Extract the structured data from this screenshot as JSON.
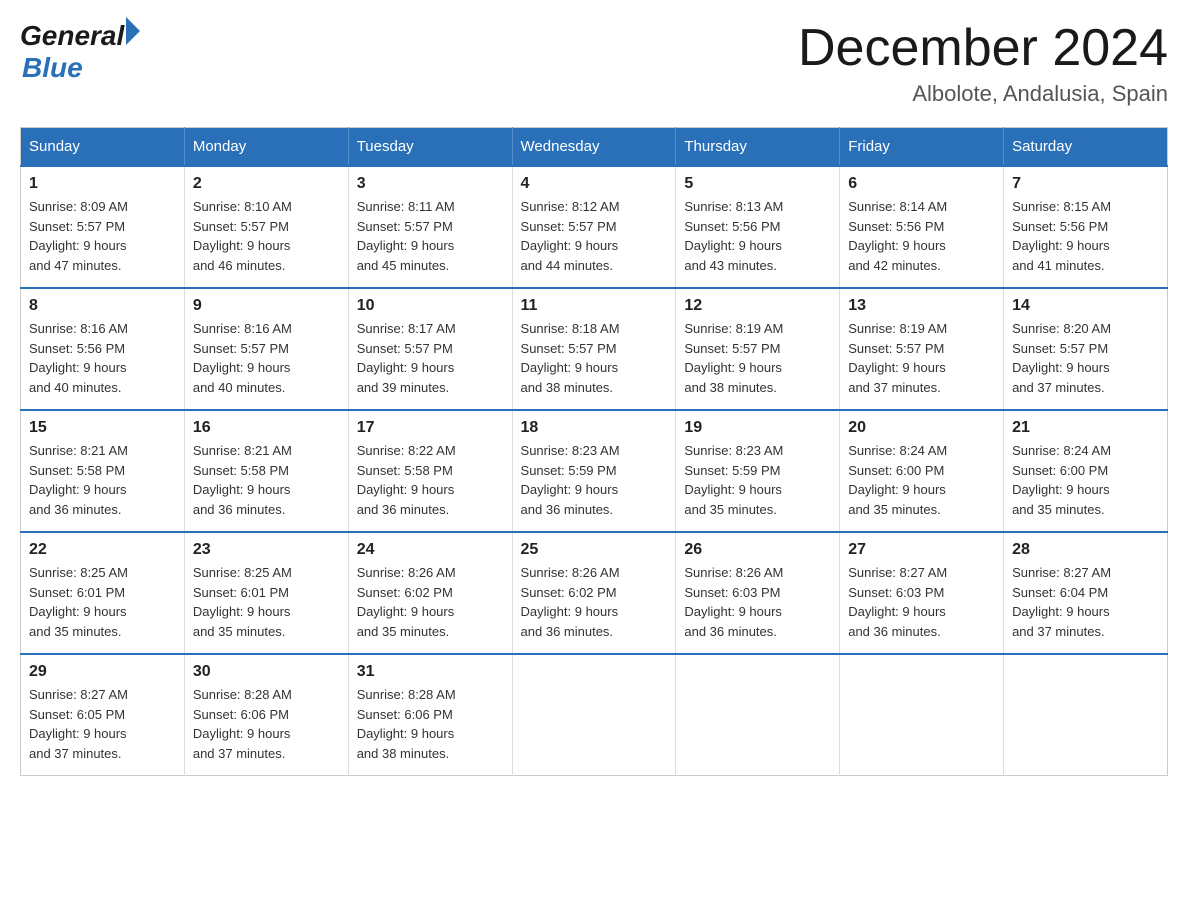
{
  "logo": {
    "general": "General",
    "arrow": "▶",
    "blue": "Blue"
  },
  "header": {
    "month_year": "December 2024",
    "location": "Albolote, Andalusia, Spain"
  },
  "days_of_week": [
    "Sunday",
    "Monday",
    "Tuesday",
    "Wednesday",
    "Thursday",
    "Friday",
    "Saturday"
  ],
  "weeks": [
    [
      {
        "day": "1",
        "sunrise": "8:09 AM",
        "sunset": "5:57 PM",
        "daylight": "9 hours and 47 minutes."
      },
      {
        "day": "2",
        "sunrise": "8:10 AM",
        "sunset": "5:57 PM",
        "daylight": "9 hours and 46 minutes."
      },
      {
        "day": "3",
        "sunrise": "8:11 AM",
        "sunset": "5:57 PM",
        "daylight": "9 hours and 45 minutes."
      },
      {
        "day": "4",
        "sunrise": "8:12 AM",
        "sunset": "5:57 PM",
        "daylight": "9 hours and 44 minutes."
      },
      {
        "day": "5",
        "sunrise": "8:13 AM",
        "sunset": "5:56 PM",
        "daylight": "9 hours and 43 minutes."
      },
      {
        "day": "6",
        "sunrise": "8:14 AM",
        "sunset": "5:56 PM",
        "daylight": "9 hours and 42 minutes."
      },
      {
        "day": "7",
        "sunrise": "8:15 AM",
        "sunset": "5:56 PM",
        "daylight": "9 hours and 41 minutes."
      }
    ],
    [
      {
        "day": "8",
        "sunrise": "8:16 AM",
        "sunset": "5:56 PM",
        "daylight": "9 hours and 40 minutes."
      },
      {
        "day": "9",
        "sunrise": "8:16 AM",
        "sunset": "5:57 PM",
        "daylight": "9 hours and 40 minutes."
      },
      {
        "day": "10",
        "sunrise": "8:17 AM",
        "sunset": "5:57 PM",
        "daylight": "9 hours and 39 minutes."
      },
      {
        "day": "11",
        "sunrise": "8:18 AM",
        "sunset": "5:57 PM",
        "daylight": "9 hours and 38 minutes."
      },
      {
        "day": "12",
        "sunrise": "8:19 AM",
        "sunset": "5:57 PM",
        "daylight": "9 hours and 38 minutes."
      },
      {
        "day": "13",
        "sunrise": "8:19 AM",
        "sunset": "5:57 PM",
        "daylight": "9 hours and 37 minutes."
      },
      {
        "day": "14",
        "sunrise": "8:20 AM",
        "sunset": "5:57 PM",
        "daylight": "9 hours and 37 minutes."
      }
    ],
    [
      {
        "day": "15",
        "sunrise": "8:21 AM",
        "sunset": "5:58 PM",
        "daylight": "9 hours and 36 minutes."
      },
      {
        "day": "16",
        "sunrise": "8:21 AM",
        "sunset": "5:58 PM",
        "daylight": "9 hours and 36 minutes."
      },
      {
        "day": "17",
        "sunrise": "8:22 AM",
        "sunset": "5:58 PM",
        "daylight": "9 hours and 36 minutes."
      },
      {
        "day": "18",
        "sunrise": "8:23 AM",
        "sunset": "5:59 PM",
        "daylight": "9 hours and 36 minutes."
      },
      {
        "day": "19",
        "sunrise": "8:23 AM",
        "sunset": "5:59 PM",
        "daylight": "9 hours and 35 minutes."
      },
      {
        "day": "20",
        "sunrise": "8:24 AM",
        "sunset": "6:00 PM",
        "daylight": "9 hours and 35 minutes."
      },
      {
        "day": "21",
        "sunrise": "8:24 AM",
        "sunset": "6:00 PM",
        "daylight": "9 hours and 35 minutes."
      }
    ],
    [
      {
        "day": "22",
        "sunrise": "8:25 AM",
        "sunset": "6:01 PM",
        "daylight": "9 hours and 35 minutes."
      },
      {
        "day": "23",
        "sunrise": "8:25 AM",
        "sunset": "6:01 PM",
        "daylight": "9 hours and 35 minutes."
      },
      {
        "day": "24",
        "sunrise": "8:26 AM",
        "sunset": "6:02 PM",
        "daylight": "9 hours and 35 minutes."
      },
      {
        "day": "25",
        "sunrise": "8:26 AM",
        "sunset": "6:02 PM",
        "daylight": "9 hours and 36 minutes."
      },
      {
        "day": "26",
        "sunrise": "8:26 AM",
        "sunset": "6:03 PM",
        "daylight": "9 hours and 36 minutes."
      },
      {
        "day": "27",
        "sunrise": "8:27 AM",
        "sunset": "6:03 PM",
        "daylight": "9 hours and 36 minutes."
      },
      {
        "day": "28",
        "sunrise": "8:27 AM",
        "sunset": "6:04 PM",
        "daylight": "9 hours and 37 minutes."
      }
    ],
    [
      {
        "day": "29",
        "sunrise": "8:27 AM",
        "sunset": "6:05 PM",
        "daylight": "9 hours and 37 minutes."
      },
      {
        "day": "30",
        "sunrise": "8:28 AM",
        "sunset": "6:06 PM",
        "daylight": "9 hours and 37 minutes."
      },
      {
        "day": "31",
        "sunrise": "8:28 AM",
        "sunset": "6:06 PM",
        "daylight": "9 hours and 38 minutes."
      },
      null,
      null,
      null,
      null
    ]
  ],
  "labels": {
    "sunrise": "Sunrise:",
    "sunset": "Sunset:",
    "daylight": "Daylight:"
  }
}
